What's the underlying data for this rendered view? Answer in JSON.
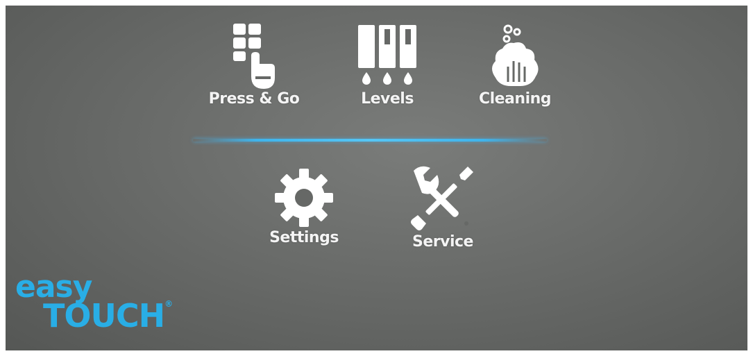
{
  "menu": {
    "press_go": {
      "label": "Press & Go",
      "icon": "press-and-go-icon"
    },
    "levels": {
      "label": "Levels",
      "icon": "levels-icon"
    },
    "cleaning": {
      "label": "Cleaning",
      "icon": "cleaning-icon"
    },
    "settings": {
      "label": "Settings",
      "icon": "gear-icon"
    },
    "service": {
      "label": "Service",
      "icon": "wrench-screwdriver-icon"
    }
  },
  "logo": {
    "line1": "easy",
    "line2": "TOUCH",
    "registered": "®"
  },
  "colors": {
    "background": "#666866",
    "accent": "#3fb4ec",
    "logo": "#29aee6",
    "icons": "#ffffff"
  }
}
